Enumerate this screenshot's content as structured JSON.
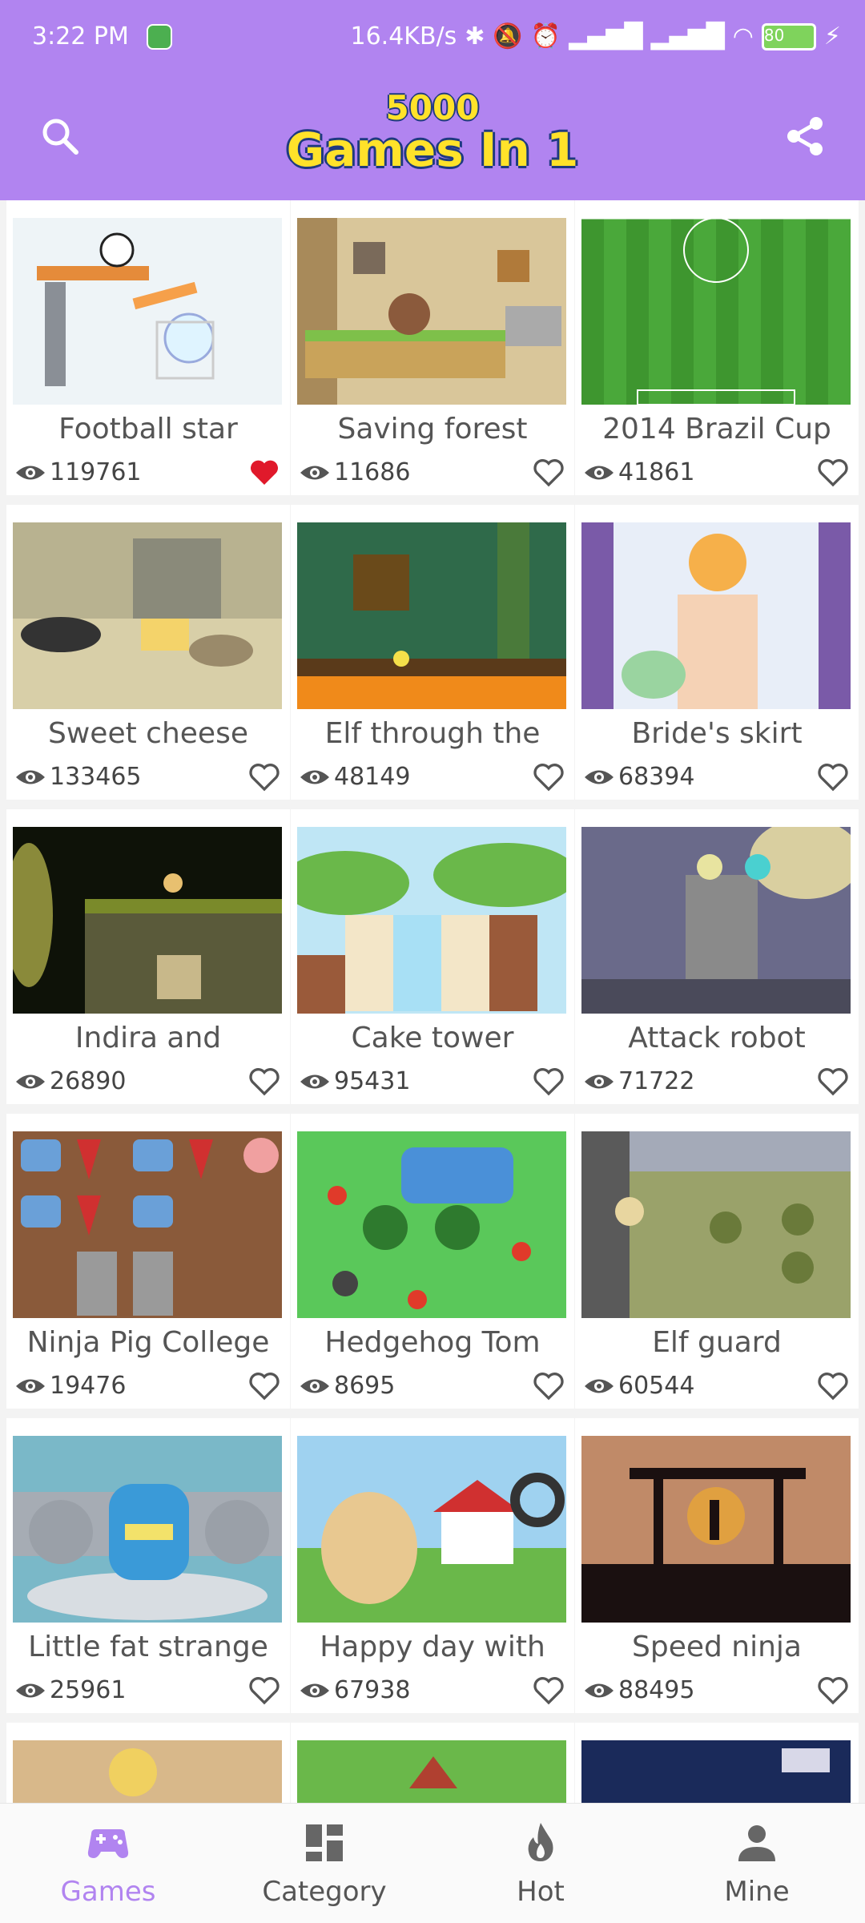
{
  "status_bar": {
    "time": "3:22 PM",
    "net_speed": "16.4KB/s",
    "battery": "80"
  },
  "app": {
    "logo_line1": "5000",
    "logo_line2": "Games In 1",
    "accent_color": "#b184f0",
    "search_icon": "search-icon",
    "share_icon": "share-icon"
  },
  "games": [
    {
      "title": "Football star",
      "views": "119761",
      "favorite": true
    },
    {
      "title": "Saving forest",
      "views": "11686",
      "favorite": false
    },
    {
      "title": "2014 Brazil Cup",
      "views": "41861",
      "favorite": false
    },
    {
      "title": "Sweet cheese",
      "views": "133465",
      "favorite": false
    },
    {
      "title": "Elf through the",
      "views": "48149",
      "favorite": false
    },
    {
      "title": "Bride's skirt",
      "views": "68394",
      "favorite": false
    },
    {
      "title": "Indira and",
      "views": "26890",
      "favorite": false
    },
    {
      "title": "Cake tower",
      "views": "95431",
      "favorite": false
    },
    {
      "title": "Attack robot",
      "views": "71722",
      "favorite": false
    },
    {
      "title": "Ninja Pig College",
      "views": "19476",
      "favorite": false
    },
    {
      "title": "Hedgehog Tom",
      "views": "8695",
      "favorite": false
    },
    {
      "title": "Elf guard",
      "views": "60544",
      "favorite": false
    },
    {
      "title": "Little fat strange",
      "views": "25961",
      "favorite": false
    },
    {
      "title": "Happy day with",
      "views": "67938",
      "favorite": false
    },
    {
      "title": "Speed ninja",
      "views": "88495",
      "favorite": false
    }
  ],
  "nav": {
    "games": "Games",
    "category": "Category",
    "hot": "Hot",
    "mine": "Mine",
    "active": "games"
  }
}
